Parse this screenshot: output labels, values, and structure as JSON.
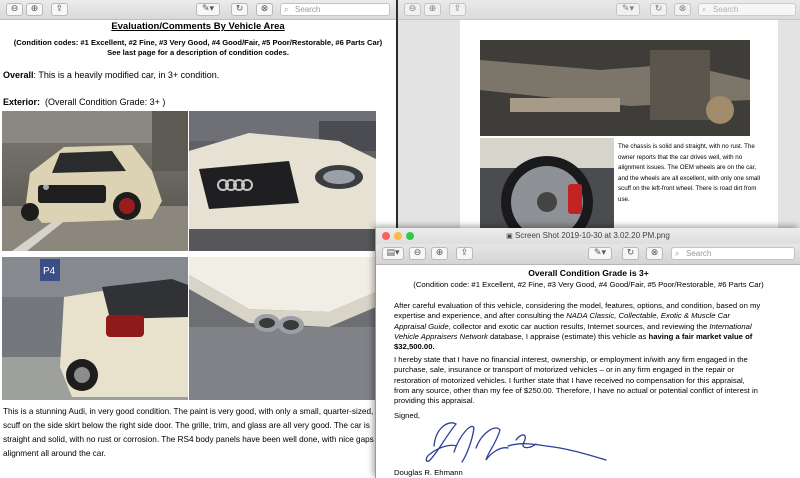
{
  "left_window": {
    "search_placeholder": "Search",
    "title": "Evaluation/Comments By Vehicle Area",
    "codes": "(Condition codes: #1 Excellent, #2 Fine, #3 Very Good, #4 Good/Fair, #5 Poor/Restorable, #6 Parts Car)",
    "codes_note": "See last page for a description of condition codes.",
    "overall_label": "Overall",
    "overall_text": ": This is a heavily modified car, in 3+ condition.",
    "exterior_label": "Exterior:",
    "exterior_grade": "(Overall Condition Grade: 3+ )",
    "p_section_label": "P4",
    "body_lines": [
      "This is a stunning Audi, in very good condition.  The paint is very good, with only a small, quarter-sized,",
      "scuff on the side skirt below the right side door.  The grille, trim, and glass are all very good.  The car is",
      "straight and solid, with no rust or corrosion.  The RS4 body panels have been well done, with nice gaps a",
      "alignment all around the car."
    ]
  },
  "right_window": {
    "search_placeholder": "Search",
    "caption_lines": [
      "The chassis is solid and straight, with no rust.  The",
      "owner reports that the car drives well, with no",
      "alignment issues.  The OEM wheels are on the car,",
      "and the wheels are all excellent, with only one small",
      "scuff on the left-front wheel.  There is road dirt from",
      "use."
    ]
  },
  "front_window": {
    "title": "Screen Shot 2019-10-30 at 3.02.20 PM.png",
    "search_placeholder": "Search",
    "grade_title": "Overall Condition Grade is 3+",
    "codes": "(Condition code: #1 Excellent, #2 Fine, #3 Very Good, #4 Good/Fair, #5 Poor/Restorable, #6 Parts Car)",
    "para1_lines": [
      "After careful evaluation of this vehicle, considering the model, features, options, and condition, based on my",
      "expertise and experience, and after consulting the ",
      "NADA Classic, Collectable, Exotic & Muscle Car",
      "Appraisal Guide",
      ", collector and exotic car auction results, Internet sources, and reviewing the ",
      "International",
      "Vehicle Appraisers Network",
      " database, I appraise (estimate) this vehicle as ",
      "having a fair market value of",
      "$32,500.00."
    ],
    "para2_lines": [
      "I hereby state that I have no financial interest, ownership, or employment in/with any firm engaged in the",
      "purchase, sale, insurance or transport of motorized vehicles – or in any firm engaged in the repair or",
      "restoration of motorized vehicles.  I further state that I have received no compensation for this appraisal,",
      "from any source, other than my fee of $250.00.  Therefore, I have no actual or potential conflict of interest in",
      "providing this appraisal."
    ],
    "signed": "Signed,",
    "signer": "Douglas R. Ehmann"
  },
  "colors": {
    "close": "#fc605c",
    "minimize": "#fdbc40",
    "zoom": "#34c84a",
    "sig_ink": "#2d3f9a"
  }
}
